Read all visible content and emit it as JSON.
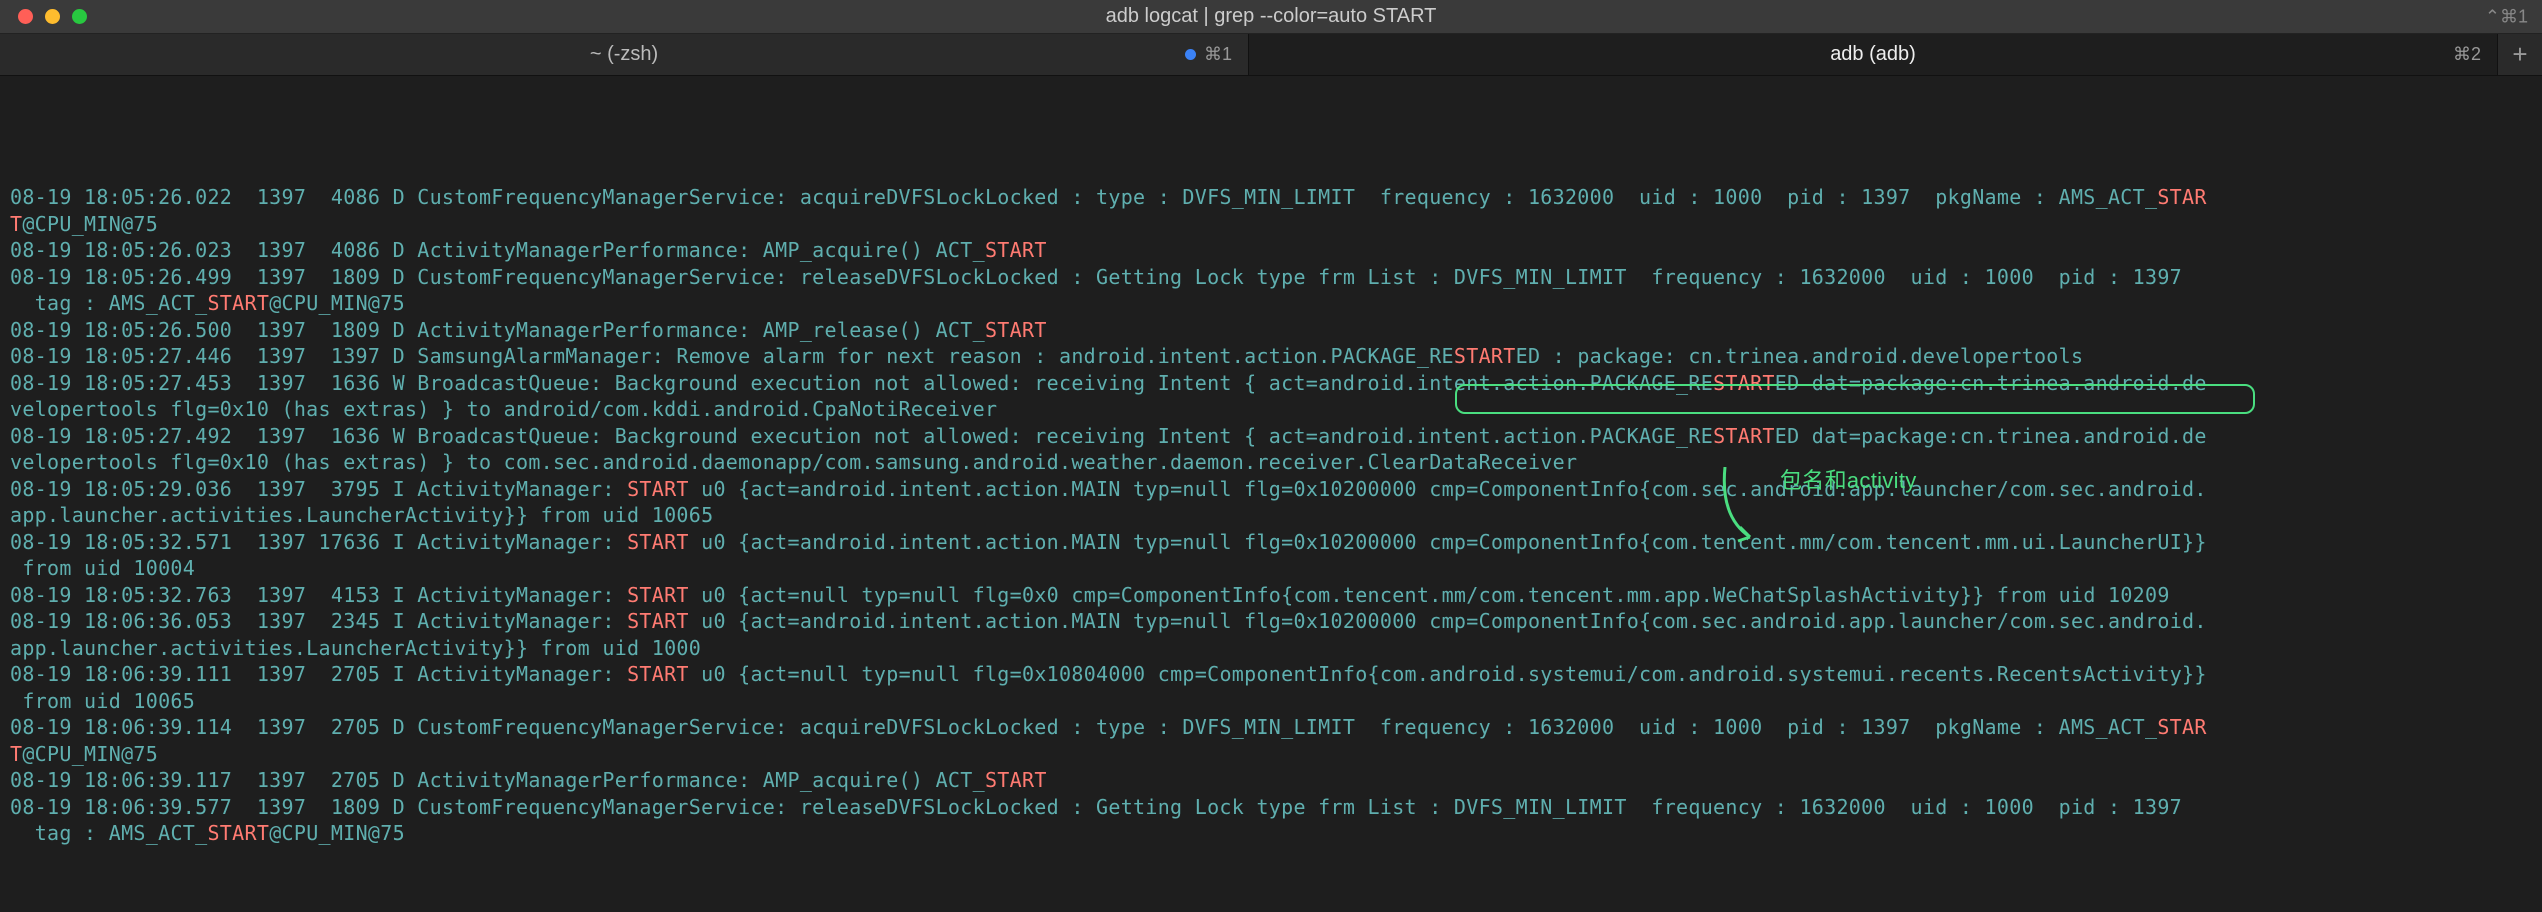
{
  "window": {
    "title": "adb logcat | grep --color=auto  START",
    "hint_shortcut": "⌃⌘1"
  },
  "tabs": [
    {
      "label": "~ (-zsh)",
      "shortcut": "⌘1",
      "active": false,
      "has_dot": true
    },
    {
      "label": "adb (adb)",
      "shortcut": "⌘2",
      "active": true,
      "has_dot": false
    }
  ],
  "annotation": {
    "label": "包名和activity",
    "boxed_text": "{com.tencent.mm/com.tencent.mm.app.WeChatSplashActivity}}"
  },
  "lines": [
    {
      "segments": [
        {
          "t": "08-19 18:05:26.022  1397  4086 D CustomFrequencyManagerService: acquireDVFSLockLocked : type : DVFS_MIN_LIMIT  frequency : 1632000  uid : 1000  pid : 1397  pkgName : AMS_ACT_"
        },
        {
          "t": "STAR",
          "hl": true
        }
      ]
    },
    {
      "segments": [
        {
          "t": "T",
          "hl": true
        },
        {
          "t": "@CPU_MIN@75"
        }
      ]
    },
    {
      "segments": [
        {
          "t": "08-19 18:05:26.023  1397  4086 D ActivityManagerPerformance: AMP_acquire() ACT_"
        },
        {
          "t": "START",
          "hl": true
        }
      ]
    },
    {
      "segments": [
        {
          "t": "08-19 18:05:26.499  1397  1809 D CustomFrequencyManagerService: releaseDVFSLockLocked : Getting Lock type frm List : DVFS_MIN_LIMIT  frequency : 1632000  uid : 1000  pid : 1397"
        }
      ]
    },
    {
      "segments": [
        {
          "t": "  tag : AMS_ACT_"
        },
        {
          "t": "START",
          "hl": true
        },
        {
          "t": "@CPU_MIN@75"
        }
      ]
    },
    {
      "segments": [
        {
          "t": "08-19 18:05:26.500  1397  1809 D ActivityManagerPerformance: AMP_release() ACT_"
        },
        {
          "t": "START",
          "hl": true
        }
      ]
    },
    {
      "segments": [
        {
          "t": "08-19 18:05:27.446  1397  1397 D SamsungAlarmManager: Remove alarm for next reason : android.intent.action.PACKAGE_RE"
        },
        {
          "t": "START",
          "hl": true
        },
        {
          "t": "ED : package: cn.trinea.android.developertools"
        }
      ]
    },
    {
      "segments": [
        {
          "t": "08-19 18:05:27.453  1397  1636 W BroadcastQueue: Background execution not allowed: receiving Intent { act=android.intent.action.PACKAGE_RE"
        },
        {
          "t": "START",
          "hl": true
        },
        {
          "t": "ED dat=package:cn.trinea.android.de"
        }
      ]
    },
    {
      "segments": [
        {
          "t": "velopertools flg=0x10 (has extras) } to android/com.kddi.android.CpaNotiReceiver"
        }
      ]
    },
    {
      "segments": [
        {
          "t": "08-19 18:05:27.492  1397  1636 W BroadcastQueue: Background execution not allowed: receiving Intent { act=android.intent.action.PACKAGE_RE"
        },
        {
          "t": "START",
          "hl": true
        },
        {
          "t": "ED dat=package:cn.trinea.android.de"
        }
      ]
    },
    {
      "segments": [
        {
          "t": "velopertools flg=0x10 (has extras) } to com.sec.android.daemonapp/com.samsung.android.weather.daemon.receiver.ClearDataReceiver"
        }
      ]
    },
    {
      "segments": [
        {
          "t": "08-19 18:05:29.036  1397  3795 I ActivityManager: "
        },
        {
          "t": "START",
          "hl": true
        },
        {
          "t": " u0 {act=android.intent.action.MAIN typ=null flg=0x10200000 cmp=ComponentInfo{com.sec.android.app.launcher/com.sec.android."
        }
      ]
    },
    {
      "segments": [
        {
          "t": "app.launcher.activities.LauncherActivity}} from uid 10065"
        }
      ]
    },
    {
      "segments": [
        {
          "t": "08-19 18:05:32.571  1397 17636 I ActivityManager: "
        },
        {
          "t": "START",
          "hl": true
        },
        {
          "t": " u0 {act=android.intent.action.MAIN typ=null flg=0x10200000 cmp=ComponentInfo{com.tencent.mm/com.tencent.mm.ui.LauncherUI}}"
        }
      ]
    },
    {
      "segments": [
        {
          "t": " from uid 10004"
        }
      ]
    },
    {
      "segments": [
        {
          "t": "08-19 18:05:32.763  1397  4153 I ActivityManager: "
        },
        {
          "t": "START",
          "hl": true
        },
        {
          "t": " u0 {act=null typ=null flg=0x0 cmp=ComponentInfo{com.tencent.mm/com.tencent.mm.app.WeChatSplashActivity}} from uid 10209"
        }
      ]
    },
    {
      "segments": [
        {
          "t": "08-19 18:06:36.053  1397  2345 I ActivityManager: "
        },
        {
          "t": "START",
          "hl": true
        },
        {
          "t": " u0 {act=android.intent.action.MAIN typ=null flg=0x10200000 cmp=ComponentInfo{com.sec.android.app.launcher/com.sec.android."
        }
      ]
    },
    {
      "segments": [
        {
          "t": "app.launcher.activities.LauncherActivity}} from uid 1000"
        }
      ]
    },
    {
      "segments": [
        {
          "t": "08-19 18:06:39.111  1397  2705 I ActivityManager: "
        },
        {
          "t": "START",
          "hl": true
        },
        {
          "t": " u0 {act=null typ=null flg=0x10804000 cmp=ComponentInfo{com.android.systemui/com.android.systemui.recents.RecentsActivity}}"
        }
      ]
    },
    {
      "segments": [
        {
          "t": " from uid 10065"
        }
      ]
    },
    {
      "segments": [
        {
          "t": "08-19 18:06:39.114  1397  2705 D CustomFrequencyManagerService: acquireDVFSLockLocked : type : DVFS_MIN_LIMIT  frequency : 1632000  uid : 1000  pid : 1397  pkgName : AMS_ACT_"
        },
        {
          "t": "STAR",
          "hl": true
        }
      ]
    },
    {
      "segments": [
        {
          "t": "T",
          "hl": true
        },
        {
          "t": "@CPU_MIN@75"
        }
      ]
    },
    {
      "segments": [
        {
          "t": "08-19 18:06:39.117  1397  2705 D ActivityManagerPerformance: AMP_acquire() ACT_"
        },
        {
          "t": "START",
          "hl": true
        }
      ]
    },
    {
      "segments": [
        {
          "t": "08-19 18:06:39.577  1397  1809 D CustomFrequencyManagerService: releaseDVFSLockLocked : Getting Lock type frm List : DVFS_MIN_LIMIT  frequency : 1632000  uid : 1000  pid : 1397"
        }
      ]
    },
    {
      "segments": [
        {
          "t": "  tag : AMS_ACT_"
        },
        {
          "t": "START",
          "hl": true
        },
        {
          "t": "@CPU_MIN@75"
        }
      ]
    }
  ]
}
